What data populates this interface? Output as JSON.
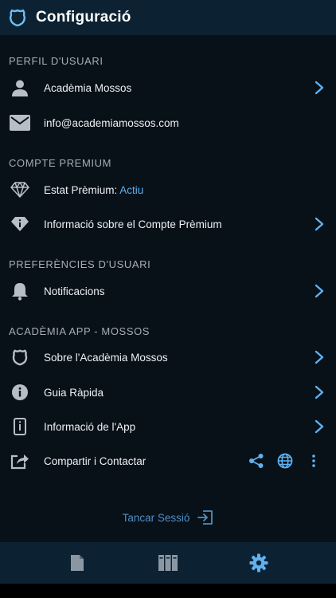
{
  "header": {
    "title": "Configuració",
    "icon": "police-badge-icon"
  },
  "sections": {
    "profile": {
      "title": "PERFIL D'USUARI",
      "name": "Acadèmia Mossos",
      "email": "info@academiamossos.com"
    },
    "premium": {
      "title": "COMPTE PREMIUM",
      "status_label": "Estat Prèmium: ",
      "status_value": "Actiu",
      "info_label": "Informació sobre el Compte Prèmium"
    },
    "preferences": {
      "title": "PREFERÈNCIES D'USUARI",
      "notifications_label": "Notificacions"
    },
    "app": {
      "title": "ACADÈMIA APP - MOSSOS",
      "about_label": "Sobre l'Acadèmia Mossos",
      "guide_label": "Guia Ràpida",
      "app_info_label": "Informació de l'App",
      "share_label": "Compartir i Contactar"
    }
  },
  "logout": {
    "label": "Tancar Sessió"
  },
  "tabs": [
    "document-icon",
    "library-icon",
    "gear-icon"
  ],
  "colors": {
    "accent": "#5fb1f0",
    "header_bg": "#0c2233",
    "page_bg": "#081018",
    "icon_gray": "#b8bec5"
  }
}
